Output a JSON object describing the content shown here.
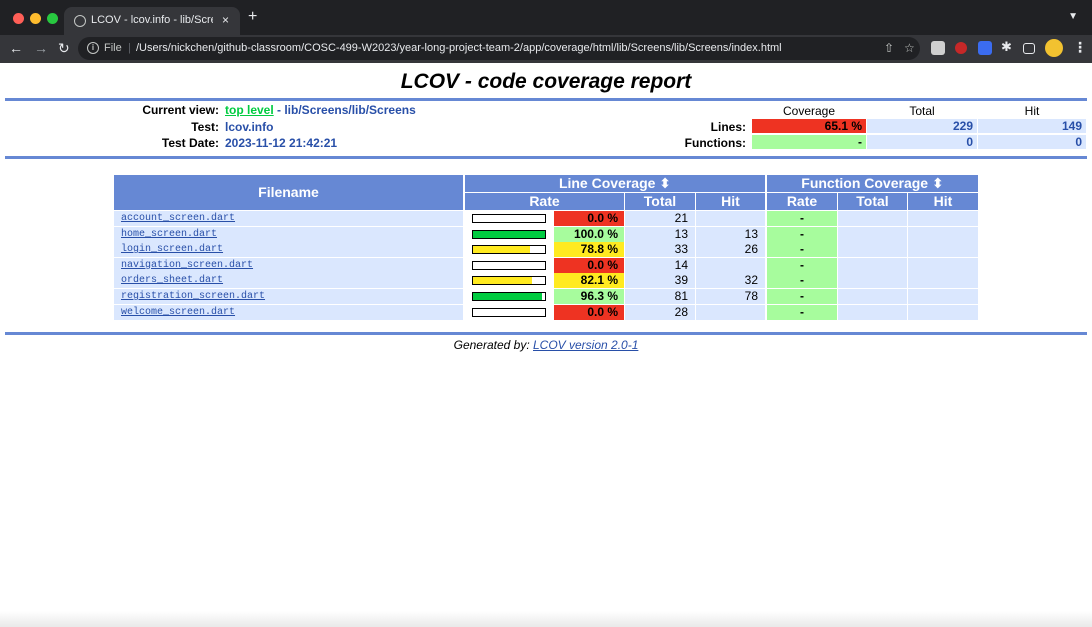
{
  "browser": {
    "tab_title": "LCOV - lcov.info - lib/Screens/",
    "tab_close": "×",
    "new_tab": "+",
    "file_label": "File",
    "url": "/Users/nickchen/github-classroom/COSC-499-W2023/year-long-project-team-2/app/coverage/html/lib/Screens/lib/Screens/index.html"
  },
  "report": {
    "title": "LCOV - code coverage report",
    "current_view_label": "Current view:",
    "top_level_link": "top level",
    "current_path": " - lib/Screens/lib/Screens",
    "test_label": "Test:",
    "test_value": "lcov.info",
    "date_label": "Test Date:",
    "date_value": "2023-11-12 21:42:21",
    "summary_headers": {
      "coverage": "Coverage",
      "total": "Total",
      "hit": "Hit"
    },
    "lines_label": "Lines:",
    "lines": {
      "coverage": "65.1 %",
      "total": "229",
      "hit": "149"
    },
    "functions_label": "Functions:",
    "functions": {
      "coverage": "-",
      "total": "0",
      "hit": "0"
    }
  },
  "table": {
    "filename_header": "Filename",
    "line_coverage_header": "Line Coverage ⬍",
    "function_coverage_header": "Function Coverage ⬍",
    "rate_header": "Rate",
    "total_header": "Total",
    "hit_header": "Hit",
    "rows": [
      {
        "file": "account_screen.dart",
        "rate": "0.0 %",
        "total": "21",
        "hit": "",
        "frate": "-",
        "level": 0.0
      },
      {
        "file": "home_screen.dart",
        "rate": "100.0 %",
        "total": "13",
        "hit": "13",
        "frate": "-",
        "level": 1.0
      },
      {
        "file": "login_screen.dart",
        "rate": "78.8 %",
        "total": "33",
        "hit": "26",
        "frate": "-",
        "level": 0.788
      },
      {
        "file": "navigation_screen.dart",
        "rate": "0.0 %",
        "total": "14",
        "hit": "",
        "frate": "-",
        "level": 0.0
      },
      {
        "file": "orders_sheet.dart",
        "rate": "82.1 %",
        "total": "39",
        "hit": "32",
        "frate": "-",
        "level": 0.821
      },
      {
        "file": "registration_screen.dart",
        "rate": "96.3 %",
        "total": "81",
        "hit": "78",
        "frate": "-",
        "level": 0.963
      },
      {
        "file": "welcome_screen.dart",
        "rate": "0.0 %",
        "total": "28",
        "hit": "",
        "frate": "-",
        "level": 0.0
      }
    ]
  },
  "footer": {
    "generated_by": "Generated by: ",
    "lcov_link": "LCOV version 2.0-1"
  },
  "colors": {
    "header_blue": "#6688d4",
    "low": "#ee3322",
    "medium": "#ffea20",
    "high": "#a7fc9d",
    "cell_blue": "#dae7fe",
    "link_blue": "#284fa8"
  }
}
